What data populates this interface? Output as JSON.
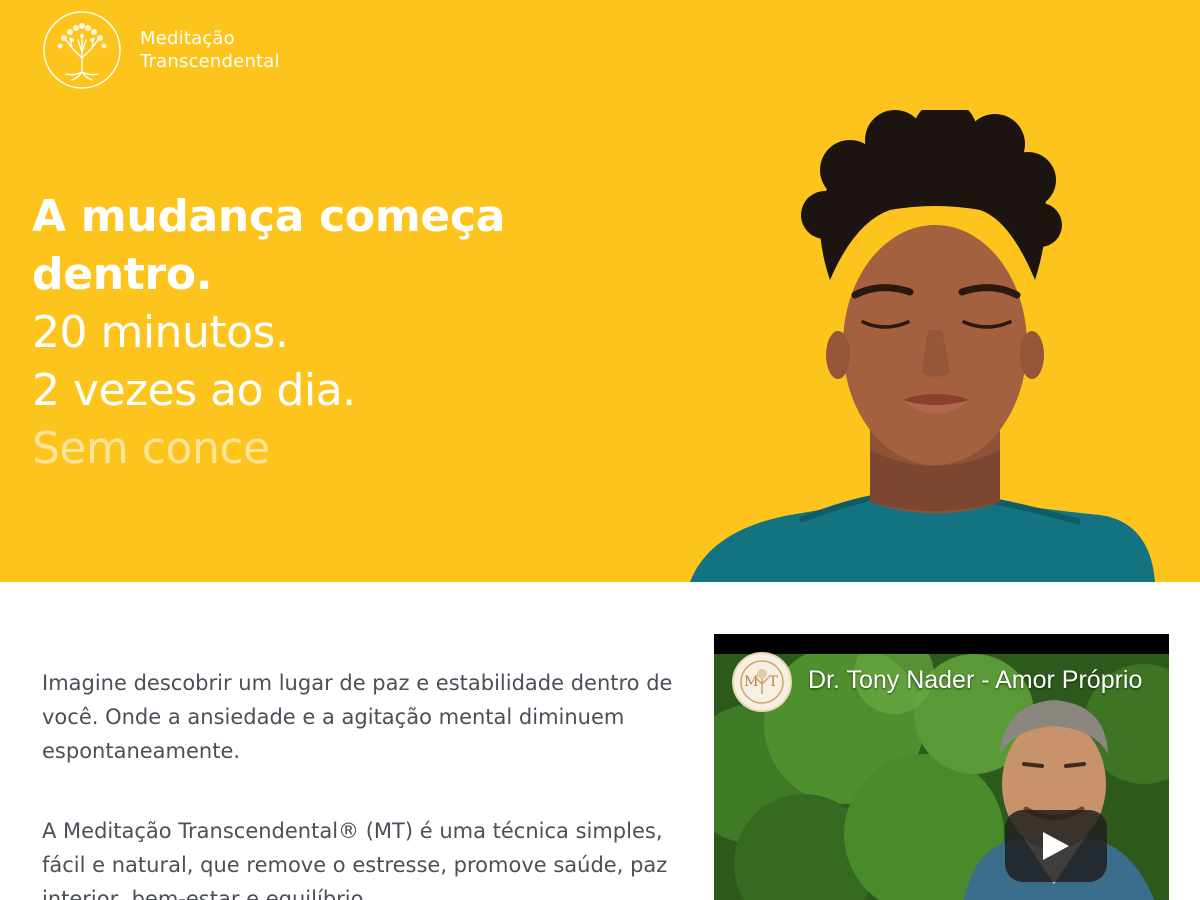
{
  "brand": {
    "line1": "Meditação",
    "line2": "Transcendental",
    "logo_icon": "tree-icon"
  },
  "hero": {
    "headline_bold_line1": "A mudança começa",
    "headline_bold_line2": "dentro.",
    "headline_line3": "20 minutos.",
    "headline_line4": "2 vezes ao dia.",
    "headline_typing": "Sem conce",
    "background_color": "#fec41e"
  },
  "intro": {
    "paragraph1": "Imagine descobrir um lugar de paz e estabilidade dentro de você. Onde a ansiedade e a agitação mental diminuem espontaneamente.",
    "paragraph2": "A Meditação Transcendental® (MT) é uma técnica simples, fácil e natural, que remove o estresse, promove saúde, paz interior, bem-estar e equilíbrio."
  },
  "video": {
    "title": "Dr. Tony Nader - Amor Próprio",
    "channel_logo_text": "MT",
    "play_icon": "play-icon"
  }
}
